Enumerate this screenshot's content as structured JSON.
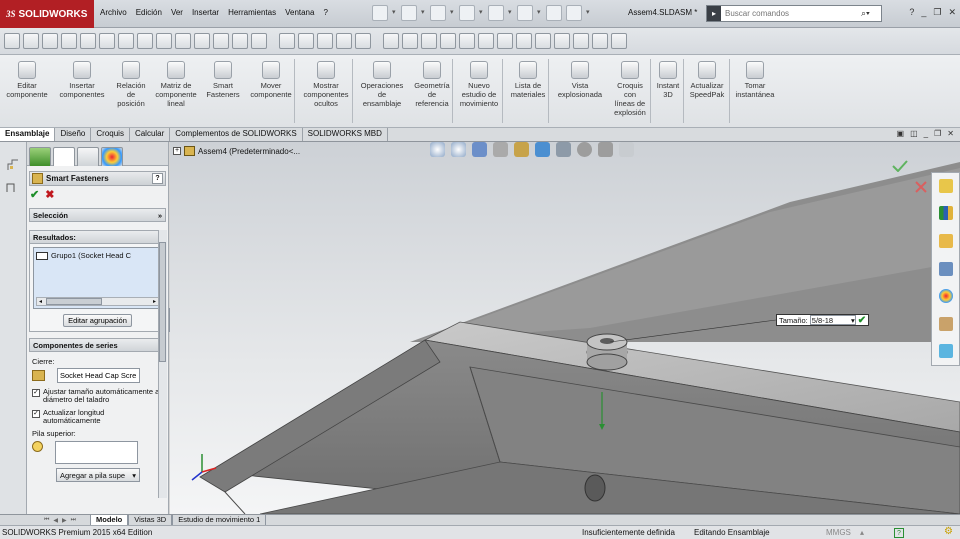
{
  "app": {
    "logo_text": "SOLIDWORKS",
    "logo_mark": "3S",
    "doc_title": "Assem4.SLDASM *"
  },
  "menu": [
    "Archivo",
    "Edición",
    "Ver",
    "Insertar",
    "Herramientas",
    "Ventana",
    "?"
  ],
  "search": {
    "placeholder": "Buscar comandos"
  },
  "window_controls": [
    "?",
    "_",
    "❐",
    "✕"
  ],
  "command_manager": [
    {
      "label": "Editar\ncomponente"
    },
    {
      "label": "Insertar\ncomponentes"
    },
    {
      "label": "Relación\nde\nposición"
    },
    {
      "label": "Matriz de\ncomponente\nlineal"
    },
    {
      "label": "Smart\nFasteners"
    },
    {
      "label": "Mover\ncomponente"
    },
    {
      "label": "Mostrar\ncomponentes\nocultos"
    },
    {
      "label": "Operaciones\nde\nensamblaje"
    },
    {
      "label": "Geometría\nde\nreferencia"
    },
    {
      "label": "Nuevo\nestudio de\nmovimiento"
    },
    {
      "label": "Lista de\nmateriales"
    },
    {
      "label": "Vista\nexplosionada"
    },
    {
      "label": "Croquis\ncon\nlíneas de\nexplosión"
    },
    {
      "label": "Instant\n3D"
    },
    {
      "label": "Actualizar\nSpeedPak"
    },
    {
      "label": "Tomar\ninstantánea"
    }
  ],
  "tabs": [
    "Ensamblaje",
    "Diseño",
    "Croquis",
    "Calcular",
    "Complementos de SOLIDWORKS",
    "SOLIDWORKS MBD"
  ],
  "active_tab": "Ensamblaje",
  "feature_tree": {
    "root": "Assem4  (Predeterminado<..."
  },
  "property_manager": {
    "title": "Smart Fasteners",
    "help": "?",
    "ok_symbol": "✔",
    "cancel_symbol": "✖",
    "selection_header": "Selección",
    "results_header": "Resultados:",
    "results_item": "Grupo1 (Socket Head C",
    "edit_group_button": "Editar agrupación",
    "series_header": "Componentes de series",
    "fastener_label": "Cierre:",
    "fastener_value": "Socket Head Cap Scre",
    "auto_size_label": "Ajustar tamaño automáticamente al diámetro del taladro",
    "auto_length_label": "Actualizar longitud automáticamente",
    "top_stack_label": "Pila superior:",
    "add_stack_button": "Agregar a pila supe"
  },
  "dimension_callout": {
    "label": "Tamaño:",
    "value": "5/8-18"
  },
  "bottom_tabs": [
    "Modelo",
    "Vistas 3D",
    "Estudio de movimiento 1"
  ],
  "active_bottom_tab": "Modelo",
  "status": {
    "edition": "SOLIDWORKS Premium 2015 x64 Edition",
    "definition": "Insuficientemente definida",
    "mode": "Editando Ensamblaje",
    "units": "MMGS"
  },
  "colors": {
    "brand_red": "#b21f24",
    "ok_green": "#1e8e2a",
    "cancel_red": "#c0181e",
    "part_gray": "#8c8c8c"
  },
  "icons": [
    "search-icon",
    "home-icon",
    "resources-icon",
    "folder-icon",
    "view-palette-icon",
    "appearance-icon",
    "custom-properties-icon",
    "forum-icon",
    "triad-icon"
  ]
}
